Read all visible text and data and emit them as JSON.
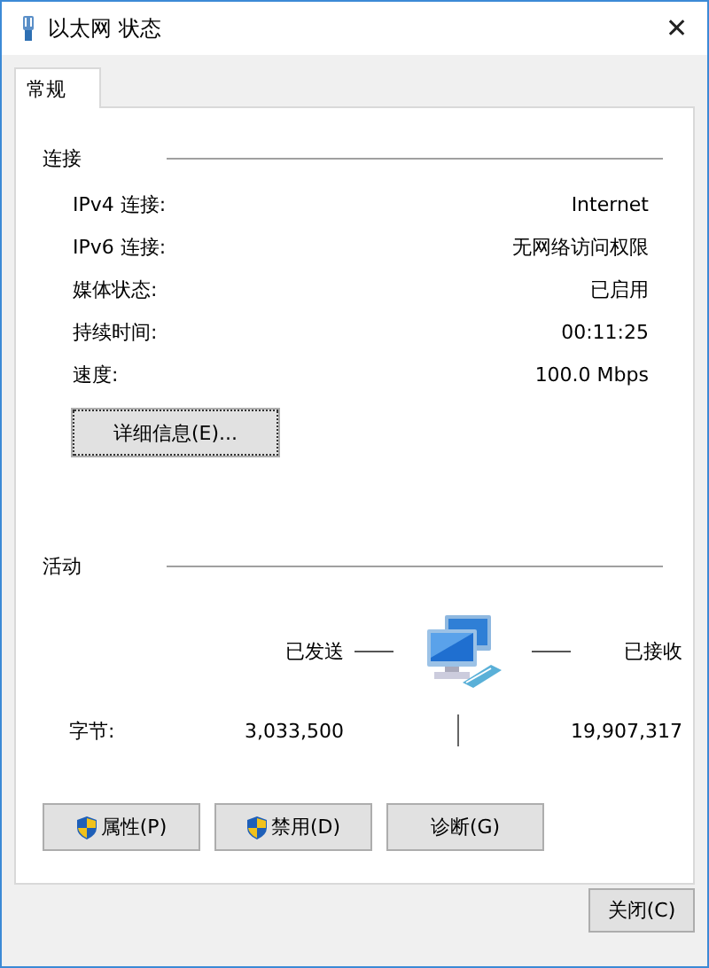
{
  "window": {
    "title": "以太网 状态",
    "close": "✕"
  },
  "tabs": [
    {
      "label": "常规",
      "selected": true
    }
  ],
  "connection": {
    "heading": "连接",
    "rows": [
      {
        "label": "IPv4 连接:",
        "value": "Internet"
      },
      {
        "label": "IPv6 连接:",
        "value": "无网络访问权限"
      },
      {
        "label": "媒体状态:",
        "value": "已启用"
      },
      {
        "label": "持续时间:",
        "value": "00:11:25"
      },
      {
        "label": "速度:",
        "value": "100.0 Mbps"
      }
    ],
    "details_button": "详细信息(E)..."
  },
  "activity": {
    "heading": "活动",
    "sent_label": "已发送",
    "received_label": "已接收",
    "bytes_label": "字节:",
    "bytes_sent": "3,033,500",
    "bytes_received": "19,907,317"
  },
  "buttons": [
    {
      "label": "属性(P)",
      "shield": true
    },
    {
      "label": "禁用(D)",
      "shield": true
    },
    {
      "label": "诊断(G)",
      "shield": false
    }
  ],
  "close_button": "关闭(C)"
}
